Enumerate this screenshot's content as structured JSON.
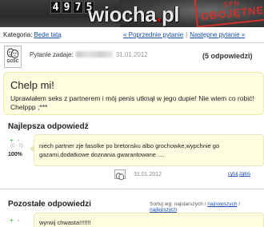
{
  "banner": {
    "counter": [
      "4",
      "9",
      "7",
      "5"
    ],
    "logo_main": "wiocha",
    "logo_dot": ".",
    "logo_tld": "pl",
    "stamp_top": "SPR",
    "stamp_bottom": "OBOJĘTNE"
  },
  "category": {
    "label": "Kategoria:",
    "value": "Bede tatą"
  },
  "nav": {
    "prev": "Poprzednie pytanie",
    "separator": "|",
    "next": "Następne pytanie"
  },
  "question": {
    "asker_label": "Pytanie zadaje:",
    "date": "31.01.2012",
    "answers_count": "(5 odpowiedzi)",
    "avatar_label": "GOŚĆ",
    "title": "Chelp mi!",
    "body": "Uprawiałem seks z partnerem i mój penis utknął w jego dupie! Nie wiem co robić! Chelppp ;***"
  },
  "best_answer": {
    "heading": "Najlepsza odpowiedź",
    "vote_up": "+",
    "vote_down": "-",
    "score": "(0 - 0)",
    "percent": "100%",
    "text": "niech partner zje fasolke po bretonsku albo grochowke,wypchnie go gazami,dodatkowe doznania gwarantowane ....",
    "date": "31.01.2012",
    "link_quote": "cytuj",
    "link_report": "zgłoś"
  },
  "other_answers": {
    "heading": "Pozostałe odpowiedzi",
    "sort_label": "Sortuj wg: najstarszych /",
    "sort_opt1": "najnowszych",
    "sort_sep": "/",
    "sort_opt2": "najlepszych",
    "vote_up": "+",
    "vote_down": "-",
    "first_text": "wyrwij chwasta!!!!!!!"
  },
  "colors": {
    "accent_link": "#1a4fb0",
    "bubble_bg": "#fdfde0",
    "stamp_red": "#d0312d"
  }
}
